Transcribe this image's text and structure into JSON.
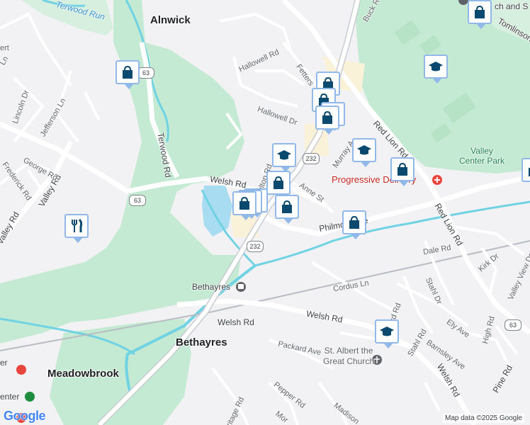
{
  "map": {
    "towns": [
      {
        "name": "Alnwick"
      },
      {
        "name": "Bethayres"
      },
      {
        "name": "Meadowbrook"
      }
    ],
    "streets": [
      "Welsh Rd",
      "Welsh Rd",
      "Welsh Rd",
      "Welsh Rd",
      "Valley Rd",
      "Valley Rd",
      "Terwood Rd",
      "Red Lion Rd",
      "Red Lion Rd",
      "Philmont Ave",
      "Anne St",
      "Walton Rd",
      "Hallowell Dr",
      "Hallowell Rd",
      "Fetters",
      "Murray A",
      "Buck Rd",
      "Tomlinson",
      "Dale Rd",
      "Cordus Ln",
      "Kirk Dr",
      "Valley View Dr",
      "Stahl Dr",
      "Stahl Rd",
      "Ely Ave",
      "Barnsley Ave",
      "High Rd",
      "Pine Rd",
      "Packard Ave",
      "Pepper Rd",
      "Madison",
      "Heritage Rd",
      "Mor",
      "Lincoln Dr",
      "Jefferson Ln",
      "George Rd",
      "Frederick Rd",
      "Ln",
      "rd Rd",
      "ert"
    ],
    "water_labels": [
      "Terwood Run"
    ],
    "route_shields": [
      "63",
      "63",
      "232",
      "232",
      "63"
    ],
    "poi": {
      "progressive": "Progressive Delivery",
      "valley_center_park": "Valley\nCenter Park",
      "church": "St. Albert the\nGreat Church",
      "station": "Bethayres",
      "partial_top_right": "ch and S",
      "partial_left_1": "er",
      "partial_left_2": "enter"
    },
    "attribution": {
      "logo": "Google",
      "map_data": "Map data ©2025 Google"
    }
  },
  "markers": [
    {
      "icon": "shopping-bag"
    },
    {
      "icon": "shopping-bag"
    },
    {
      "icon": "shopping-bag"
    },
    {
      "icon": "shopping-bag"
    },
    {
      "icon": "shopping-bag"
    },
    {
      "icon": "shopping-bag"
    },
    {
      "icon": "shopping-bag"
    },
    {
      "icon": "shopping-bag"
    },
    {
      "icon": "shopping-bag"
    },
    {
      "icon": "shopping-bag"
    },
    {
      "icon": "shopping-bag"
    },
    {
      "icon": "shopping-bag"
    },
    {
      "icon": "shopping-bag"
    },
    {
      "icon": "shopping-bag"
    },
    {
      "icon": "graduation-cap"
    },
    {
      "icon": "graduation-cap"
    },
    {
      "icon": "graduation-cap"
    },
    {
      "icon": "graduation-cap"
    },
    {
      "icon": "fork-knife"
    }
  ],
  "colors": {
    "background": "#f2f2f4",
    "park": "#c5ead3",
    "park_light": "#d7efde",
    "water": "#a8dcf0",
    "stream": "#6fd3e3",
    "road": "#ffffff",
    "highway": "#c8ccd2",
    "marker_border": "#90b8e8",
    "marker_icon": "#0b4a6e",
    "rail": "#b8bcc2",
    "commercial": "#faf1d9"
  }
}
